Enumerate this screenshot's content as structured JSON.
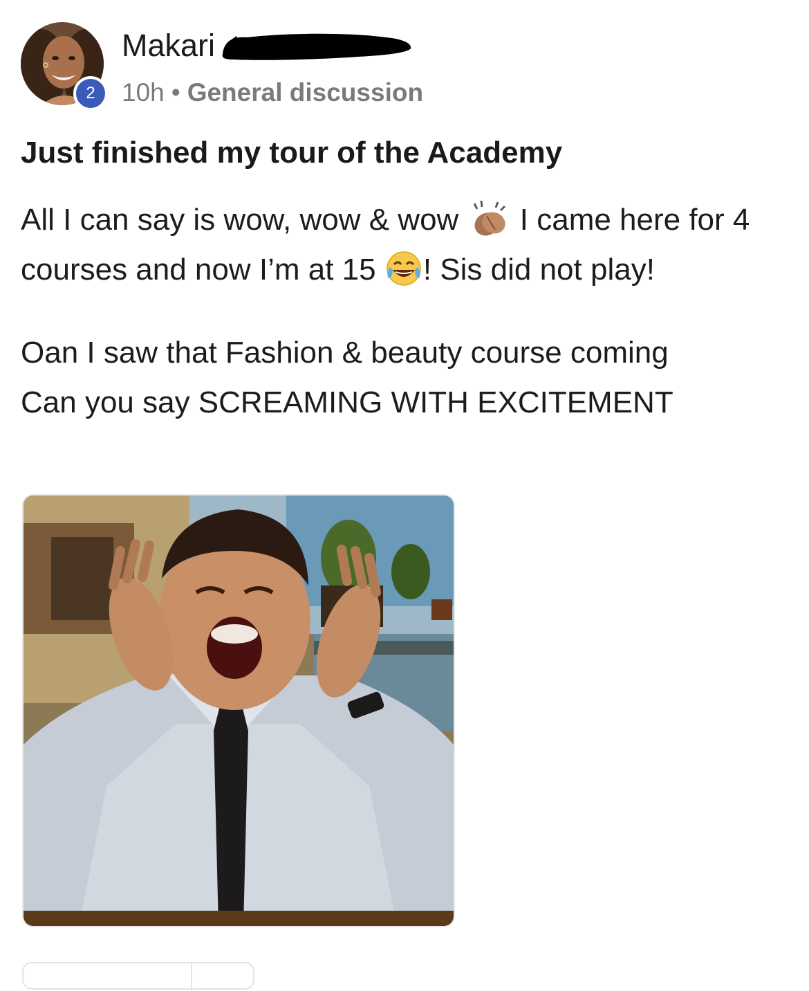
{
  "author": {
    "name": "Makari",
    "level": "2"
  },
  "meta": {
    "time": "10h",
    "separator": "•",
    "category": "General discussion"
  },
  "post": {
    "title": "Just finished my tour of the Academy",
    "paragraph1": {
      "part1": "All I can say is wow, wow & wow ",
      "emoji1": "clapping-hands-emoji",
      "part2": " I came here for 4 courses and now I’m at 15 ",
      "emoji2": "tears-of-joy-emoji",
      "part3": "! Sis did not play!"
    },
    "paragraph2": {
      "line1": "Oan I saw that Fashion & beauty course coming",
      "line2": "Can you say SCREAMING WITH EXCITEMENT"
    }
  },
  "media": {
    "type": "gif-image",
    "icon": "excited-man-gif"
  },
  "colors": {
    "badge": "#3b5bb8",
    "meta_text": "#7a7a7a",
    "body_text": "#1c1c1c"
  }
}
